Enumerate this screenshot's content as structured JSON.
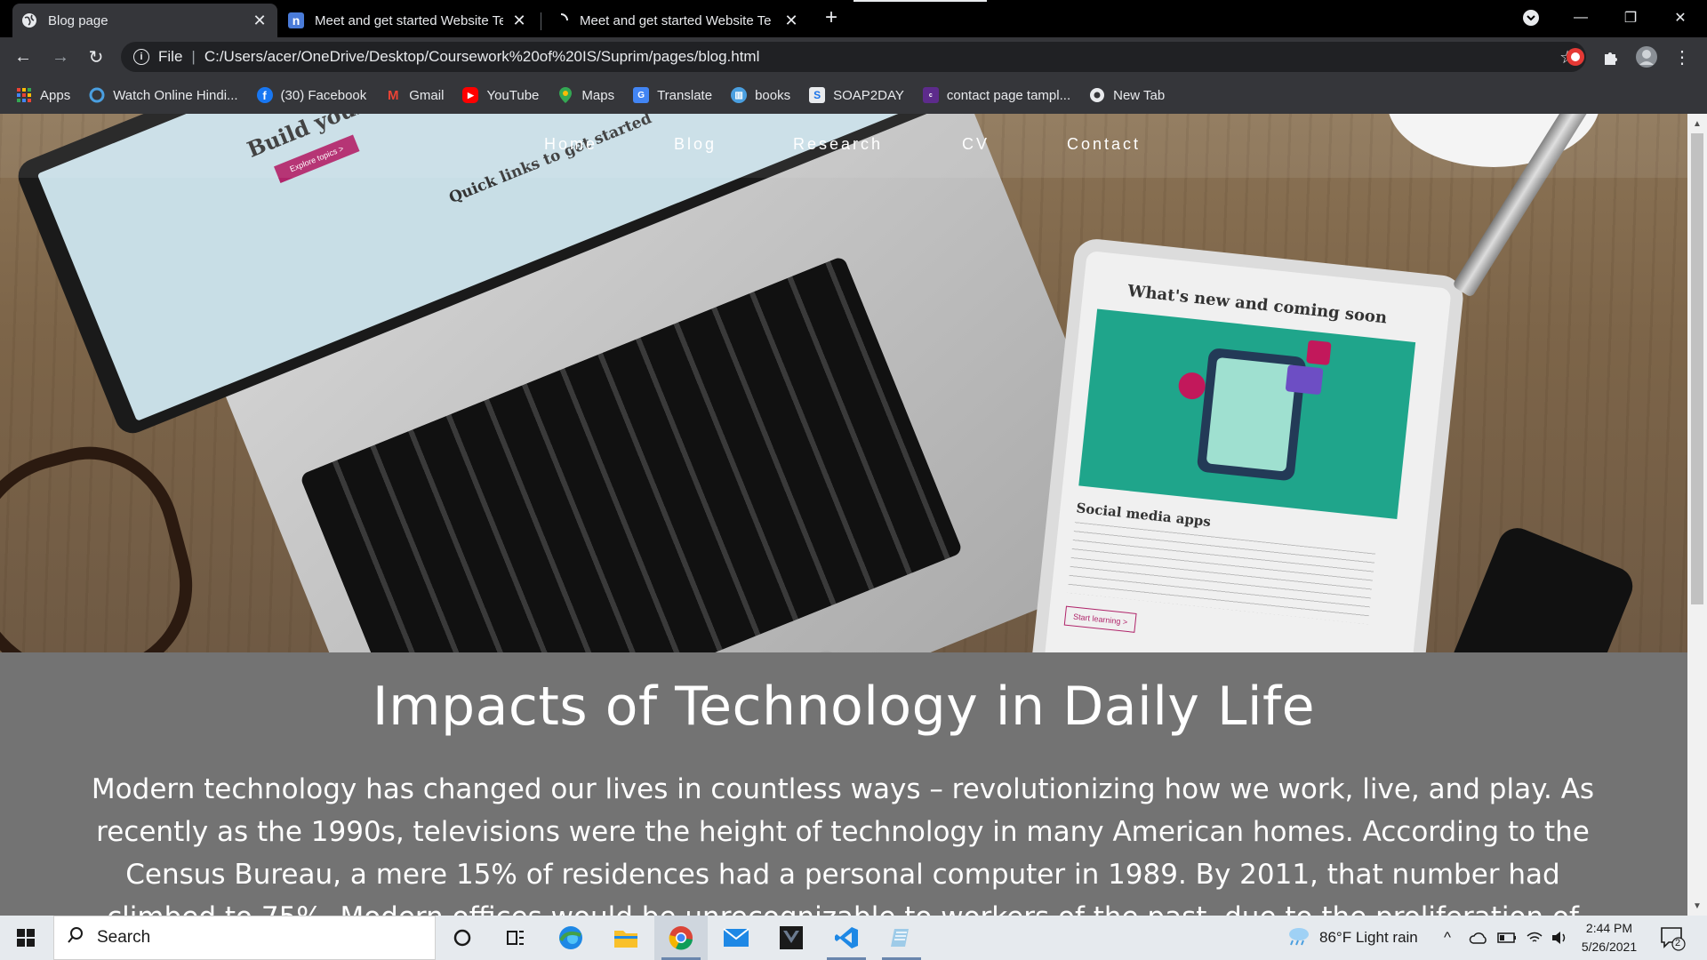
{
  "browser": {
    "tabs": [
      {
        "title": "Blog page",
        "active": true
      },
      {
        "title": "Meet and get started Website Te",
        "active": false
      },
      {
        "title": "Meet and get started Website Te",
        "active": false,
        "loading": true
      }
    ],
    "omnibox": {
      "scheme_label": "File",
      "divider": "|",
      "url": "C:/Users/acer/OneDrive/Desktop/Coursework%20of%20IS/Suprim/pages/blog.html"
    },
    "bookmarks": [
      {
        "label": "Apps",
        "icon": "apps-grid-icon"
      },
      {
        "label": "Watch Online Hindi...",
        "icon": "bookmark-site-icon"
      },
      {
        "label": "(30) Facebook",
        "icon": "facebook-icon"
      },
      {
        "label": "Gmail",
        "icon": "gmail-icon"
      },
      {
        "label": "YouTube",
        "icon": "youtube-icon"
      },
      {
        "label": "Maps",
        "icon": "maps-icon"
      },
      {
        "label": "Translate",
        "icon": "translate-icon"
      },
      {
        "label": "books",
        "icon": "books-icon"
      },
      {
        "label": "SOAP2DAY",
        "icon": "soap2day-icon"
      },
      {
        "label": "contact page tampl...",
        "icon": "colorlib-icon"
      },
      {
        "label": "New Tab",
        "icon": "chrome-icon"
      }
    ]
  },
  "page": {
    "nav": [
      "Home",
      "Blog",
      "Research",
      "CV",
      "Contact"
    ],
    "hero_tablet_title": "What's new and coming soon",
    "hero_tablet_subtitle": "Social media apps",
    "hero_tablet_button": "Start learning >",
    "hero_laptop_text_1": "Build your online",
    "hero_laptop_text_2": "Quick links to get started",
    "hero_laptop_btn": "Explore topics >",
    "headline": "Impacts of Technology in Daily Life",
    "body": "Modern technology has changed our lives in countless ways – revolutionizing how we work, live, and play. As recently as the 1990s, televisions were the height of technology in many American homes. According to the Census Bureau, a mere 15% of residences had a personal computer in 1989. By 2011, that number had climbed to 75%. Modern offices would be unrecognizable to workers of the past, due to the proliferation of email, video conferencing, smart phones"
  },
  "taskbar": {
    "search_placeholder": "Search",
    "weather": "86°F  Light rain",
    "time": "2:44 PM",
    "date": "5/26/2021",
    "notification_count": "2"
  },
  "colors": {
    "page_bg": "#737373",
    "tab_active": "#35363a",
    "tabstrip": "#000000"
  }
}
